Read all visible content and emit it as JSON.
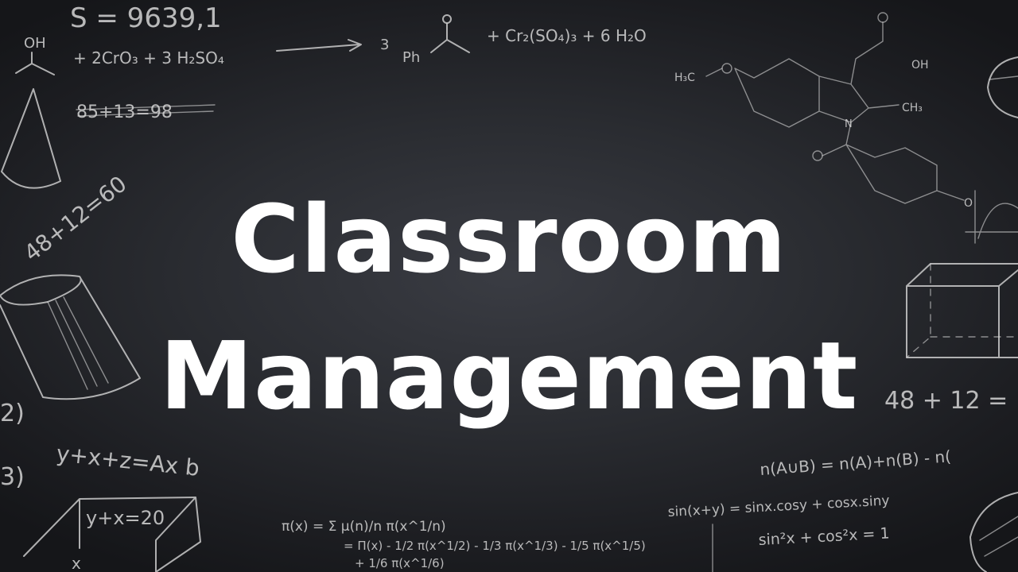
{
  "title": {
    "line1": "Classroom",
    "line2": "Management"
  },
  "chalk_notes": {
    "top_left_number": "S = 9639,1",
    "reaction_left": "+ 2CrO₃ + 3 H₂SO₄",
    "reaction_coef": "3",
    "reaction_ph": "Ph",
    "reaction_right": "+ Cr₂(SO₄)₃ + 6 H₂O",
    "oh_label": "OH",
    "scratched": "85+13=98",
    "diag_eq": "48+12=60",
    "h3c": "H₃C",
    "ch3": "CH₃",
    "oh_right": "OH",
    "n_label": "N",
    "o_label": "O",
    "eq_right_1": "48 + 12 =",
    "eq_right_2": "n(A∪B) = n(A)+n(B) - n(",
    "eq_right_3": "sin(x+y) = sinx.cosy + cosx.siny",
    "eq_right_4": "sin²x + cos²x = 1",
    "eq_left_1": "2)",
    "eq_left_2": "y+x+z=Ax b",
    "eq_left_3": "3)",
    "eq_box": "y+x=20",
    "eq_box_2": "x",
    "pi_1": "π(x) = Σ μ(n)/n π(x^1/n)",
    "pi_2": "= Π(x) - 1/2 π(x^1/2) - 1/3 π(x^1/3) - 1/5 π(x^1/5)",
    "pi_3": "+ 1/6 π(x^1/6)"
  }
}
